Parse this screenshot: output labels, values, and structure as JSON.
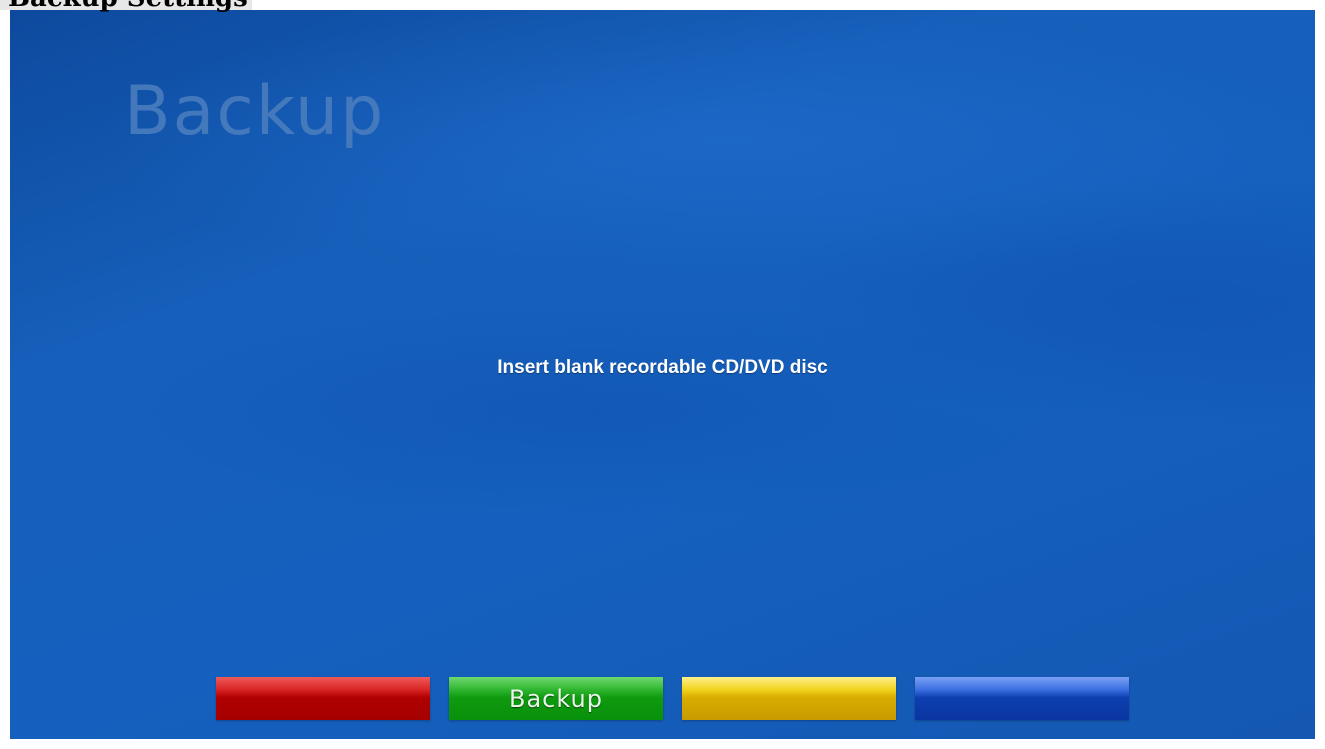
{
  "page": {
    "header": "Backup Settings"
  },
  "screen": {
    "title": "Backup",
    "message": "Insert blank recordable CD/DVD disc"
  },
  "buttons": {
    "red": {
      "label": ""
    },
    "green": {
      "label": "Backup"
    },
    "yellow": {
      "label": ""
    },
    "blue": {
      "label": ""
    }
  },
  "colors": {
    "background": "#1560be",
    "title_text": "#4d7fbf",
    "message_text": "#ffffff",
    "red_button": "#b00000",
    "green_button": "#0f9a0f",
    "yellow_button": "#d8ac00",
    "blue_button": "#0d3fb0"
  }
}
